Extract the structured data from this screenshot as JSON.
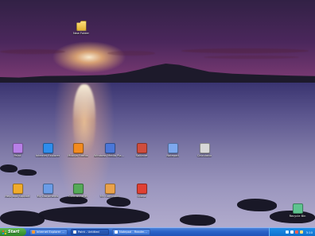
{
  "desktop": {
    "icons": [
      {
        "name": "top-folder",
        "label": "New Folder",
        "icon": "folder-icon",
        "color": "#ffd45e"
      },
      {
        "name": "row1-icon-1",
        "label": "Paint",
        "icon": "paint-icon",
        "color": "#b77fe7"
      },
      {
        "name": "row1-icon-2",
        "label": "Internet Explorer",
        "icon": "internet-explorer-icon",
        "color": "#2e8ded"
      },
      {
        "name": "row1-icon-3",
        "label": "Mozilla Firefox",
        "icon": "firefox-icon",
        "color": "#f38b1f"
      },
      {
        "name": "row1-icon-4",
        "label": "Windows Media Player",
        "icon": "media-player-icon",
        "color": "#4b77d8"
      },
      {
        "name": "row1-icon-5",
        "label": "Solitaire",
        "icon": "solitaire-icon",
        "color": "#d04d3d"
      },
      {
        "name": "row1-icon-6",
        "label": "Notepad",
        "icon": "notepad-icon",
        "color": "#7da8ee"
      },
      {
        "name": "row1-icon-7",
        "label": "Calculator",
        "icon": "calculator-icon",
        "color": "#d8d8d8"
      },
      {
        "name": "row2-icon-1",
        "label": "Help and Support",
        "icon": "help-icon",
        "color": "#f1ab2a"
      },
      {
        "name": "row2-icon-2",
        "label": "My Documents",
        "icon": "documents-icon",
        "color": "#6a9ce7"
      },
      {
        "name": "row2-icon-3",
        "label": "Control Panel",
        "icon": "control-panel-icon",
        "color": "#55aa58"
      },
      {
        "name": "row2-icon-4",
        "label": "My Computer",
        "icon": "computer-icon",
        "color": "#eaa24a"
      },
      {
        "name": "row2-icon-5",
        "label": "Opera",
        "icon": "opera-icon",
        "color": "#e04033"
      },
      {
        "name": "recycle-bin",
        "label": "Recycle Bin",
        "icon": "recycle-bin-icon",
        "color": "#5ec48f"
      }
    ]
  },
  "taskbar": {
    "start_label": "Start",
    "windows": [
      {
        "label": "Internet Explorer - Bing",
        "icon": "ie-icon",
        "color": "#ff9933",
        "active": false
      },
      {
        "label": "Paint - Untitled",
        "icon": "paint-icon",
        "color": "#f2f2f2",
        "active": true
      },
      {
        "label": "Notepad - Readme.txt",
        "icon": "notepad-icon",
        "color": "#ffffff",
        "active": false
      }
    ],
    "tray": {
      "icons": [
        "network-icon",
        "volume-icon",
        "security-icon",
        "update-icon"
      ],
      "clock": "3:10"
    }
  }
}
